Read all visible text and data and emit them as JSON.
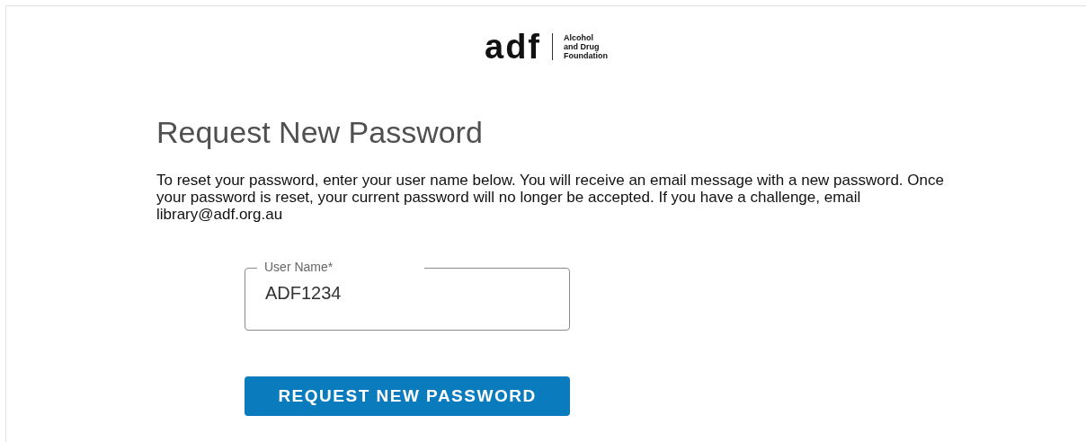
{
  "logo": {
    "mark": "adf",
    "name_lines": [
      "Alcohol",
      "and Drug",
      "Foundation"
    ]
  },
  "title": "Request New Password",
  "instructions": "To reset your password, enter your user name below. You will receive an email message with a new password. Once your password is reset, your current password will no longer be accepted. If you have a challenge, email library@adf.org.au",
  "field": {
    "label": "User Name*",
    "value": "ADF1234"
  },
  "button": "REQUEST NEW PASSWORD"
}
